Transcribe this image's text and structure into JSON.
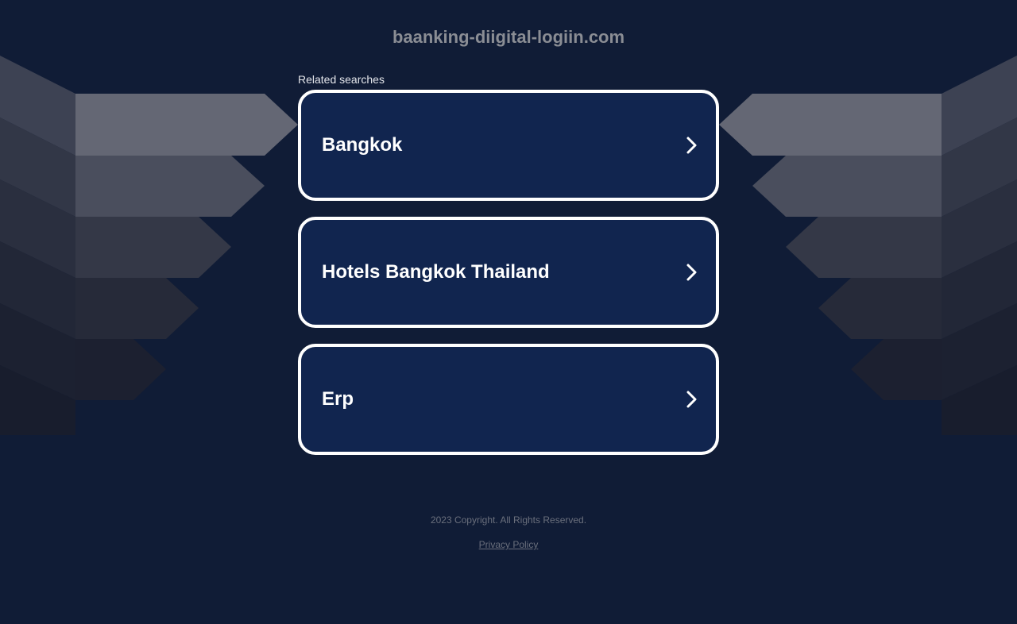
{
  "site": {
    "domain": "baanking-diigital-logiin.com"
  },
  "related": {
    "label": "Related searches",
    "items": [
      {
        "label": "Bangkok"
      },
      {
        "label": "Hotels Bangkok Thailand"
      },
      {
        "label": "Erp"
      }
    ]
  },
  "footer": {
    "copyright": "2023 Copyright. All Rights Reserved.",
    "privacy_label": "Privacy Policy"
  },
  "colors": {
    "background": "#101c36",
    "card_fill": "#11254f",
    "card_border": "#ffffff",
    "title_text": "#8a8d94",
    "footer_text": "#6a6f7c"
  },
  "icons": {
    "card_arrow": "chevron-right-icon"
  }
}
